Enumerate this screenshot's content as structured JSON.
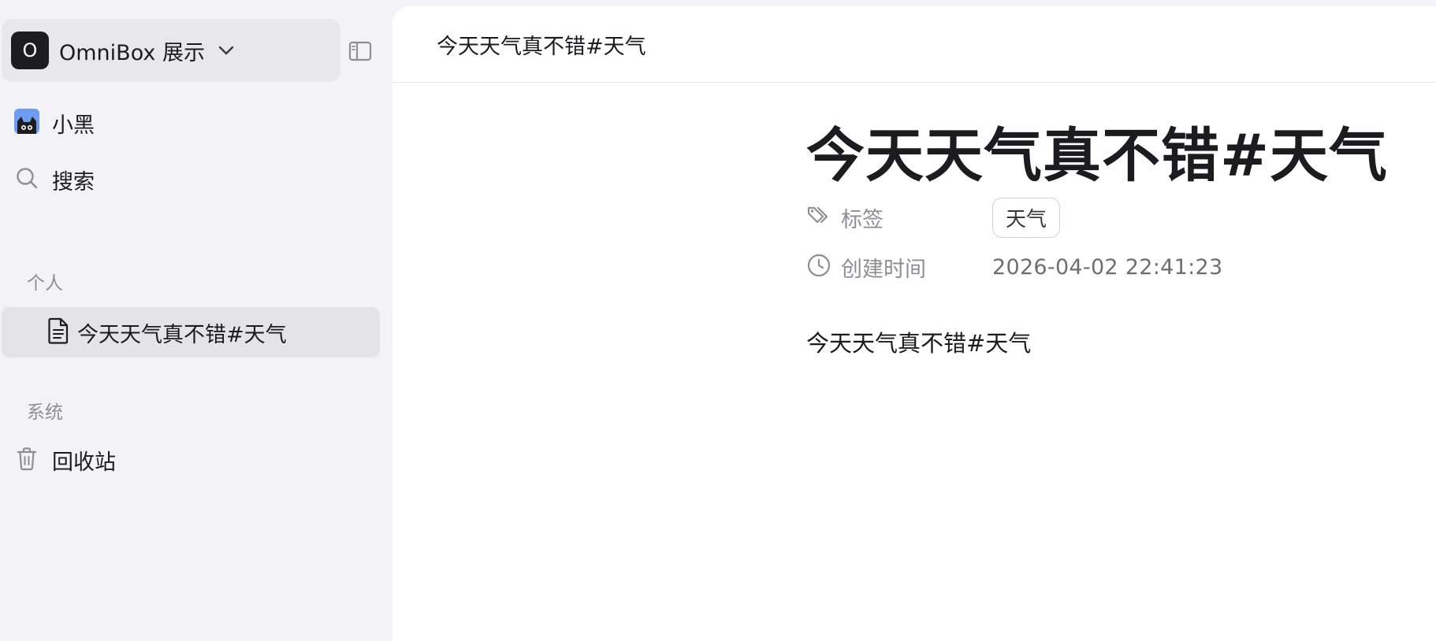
{
  "workspace": {
    "avatar_letter": "O",
    "name": "OmniBox 展示"
  },
  "nav": {
    "user_label": "小黑",
    "search_label": "搜索"
  },
  "sections": {
    "personal_label": "个人",
    "system_label": "系统"
  },
  "personal_items": [
    {
      "label": "今天天气真不错#天气"
    }
  ],
  "system_items": [
    {
      "label": "回收站"
    }
  ],
  "document": {
    "breadcrumb_title": "今天天气真不错#天气",
    "title": "今天天气真不错#天气",
    "properties": {
      "tags_label": "标签",
      "tag_value": "天气",
      "created_label": "创建时间",
      "created_value": "2026-04-02 22:41:23"
    },
    "body": "今天天气真不错#天气"
  },
  "colors": {
    "sidebar_bg": "#f2f2f7",
    "active_item_bg": "#e3e3e8",
    "muted_text": "#8e8e93"
  }
}
